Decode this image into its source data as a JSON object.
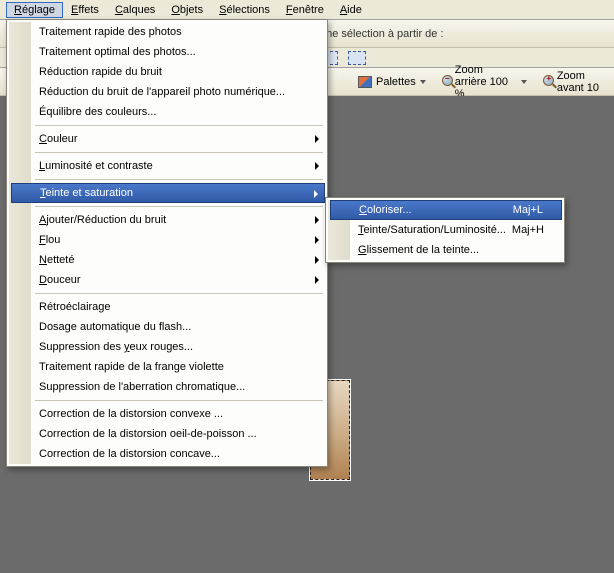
{
  "menubar": {
    "items": [
      {
        "label": "Réglage",
        "mnemonic": "R"
      },
      {
        "label": "Effets",
        "mnemonic": "E"
      },
      {
        "label": "Calques",
        "mnemonic": "C"
      },
      {
        "label": "Objets",
        "mnemonic": "O"
      },
      {
        "label": "Sélections",
        "mnemonic": "S"
      },
      {
        "label": "Fenêtre",
        "mnemonic": "F"
      },
      {
        "label": "Aide",
        "mnemonic": "A"
      }
    ]
  },
  "toolbar": {
    "selection_hint": "une sélection à partir de :",
    "palettes_label": "Palettes",
    "zoom_out_label": "Zoom arrière 100 %",
    "zoom_in_label": "Zoom avant 10"
  },
  "menu": {
    "items": [
      {
        "type": "item",
        "label": "Traitement rapide des photos"
      },
      {
        "type": "item",
        "label": "Traitement optimal des photos..."
      },
      {
        "type": "item",
        "label": "Réduction rapide du bruit"
      },
      {
        "type": "item",
        "label": "Réduction du bruit de l'appareil photo numérique..."
      },
      {
        "type": "item",
        "label": "Équilibre des couleurs..."
      },
      {
        "type": "sep"
      },
      {
        "type": "item",
        "label": "Couleur",
        "mnemonic": "C",
        "submenu": true
      },
      {
        "type": "sep"
      },
      {
        "type": "item",
        "label": "Luminosité et contraste",
        "mnemonic": "L",
        "submenu": true
      },
      {
        "type": "sep"
      },
      {
        "type": "item",
        "label": "Teinte et saturation",
        "mnemonic": "T",
        "submenu": true,
        "highlight": true
      },
      {
        "type": "sep"
      },
      {
        "type": "item",
        "label": "Ajouter/Réduction du bruit",
        "mnemonic": "A",
        "submenu": true
      },
      {
        "type": "item",
        "label": "Flou",
        "mnemonic": "F",
        "submenu": true
      },
      {
        "type": "item",
        "label": "Netteté",
        "mnemonic": "N",
        "submenu": true
      },
      {
        "type": "item",
        "label": "Douceur",
        "mnemonic": "D",
        "submenu": true
      },
      {
        "type": "sep"
      },
      {
        "type": "item",
        "label": "Rétroéclairage"
      },
      {
        "type": "item",
        "label": "Dosage automatique du flash..."
      },
      {
        "type": "item",
        "label": "Suppression des yeux rouges...",
        "mnemonic": "y"
      },
      {
        "type": "item",
        "label": "Traitement rapide de la frange violette"
      },
      {
        "type": "item",
        "label": "Suppression de l'aberration chromatique..."
      },
      {
        "type": "sep"
      },
      {
        "type": "item",
        "label": "Correction de la distorsion convexe ..."
      },
      {
        "type": "item",
        "label": "Correction de la distorsion oeil-de-poisson ..."
      },
      {
        "type": "item",
        "label": "Correction de la distorsion concave..."
      }
    ]
  },
  "submenu": {
    "items": [
      {
        "type": "item",
        "label": "Coloriser...",
        "mnemonic": "C",
        "shortcut": "Maj+L",
        "highlight": true
      },
      {
        "type": "item",
        "label": "Teinte/Saturation/Luminosité...",
        "mnemonic": "T",
        "shortcut": "Maj+H"
      },
      {
        "type": "item",
        "label": "Glissement de la teinte...",
        "mnemonic": "G"
      }
    ]
  }
}
